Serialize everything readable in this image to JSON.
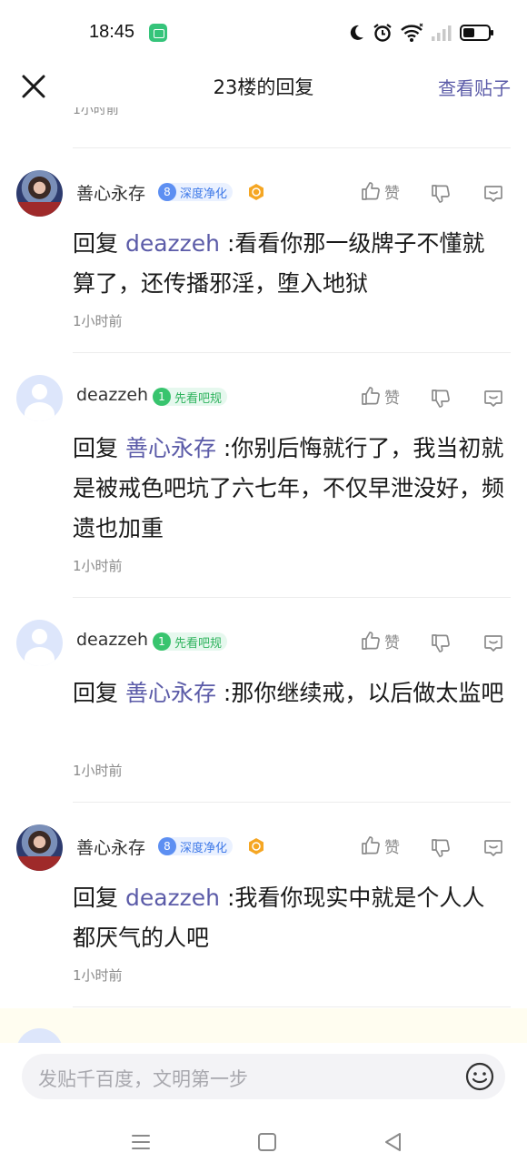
{
  "status_bar": {
    "time": "18:45",
    "icons": [
      "app-icon",
      "moon-icon",
      "alarm-icon",
      "wifi-icon",
      "signal-icon",
      "battery-icon"
    ]
  },
  "nav": {
    "title": "23楼的回复",
    "view_post": "查看贴子"
  },
  "partial_top_time": "1小时前",
  "colors": {
    "mention": "#5b5ba8",
    "badge_blue": "#3e79e8",
    "badge_green": "#2fb35e",
    "medal": "#f5a623"
  },
  "comments": [
    {
      "username": "善心永存",
      "badge_level": "8",
      "badge_title": "深度净化",
      "has_medal": true,
      "like_label": "赞",
      "reply_prefix": "回复 ",
      "mention": "deazzeh",
      "text": " :看看你那一级牌子不懂就算了，还传播邪淫，堕入地狱",
      "time": "1小时前"
    },
    {
      "username": "deazzeh",
      "badge_level": "1",
      "badge_title": "先看吧规",
      "has_medal": false,
      "like_label": "赞",
      "reply_prefix": "回复 ",
      "mention": "善心永存",
      "text": " :你别后悔就行了，我当初就是被戒色吧坑了六七年，不仅早泄没好，频遗也加重",
      "time": "1小时前"
    },
    {
      "username": "deazzeh",
      "badge_level": "1",
      "badge_title": "先看吧规",
      "has_medal": false,
      "like_label": "赞",
      "reply_prefix": "回复 ",
      "mention": "善心永存",
      "text": " :那你继续戒，以后做太监吧",
      "time": "1小时前"
    },
    {
      "username": "善心永存",
      "badge_level": "8",
      "badge_title": "深度净化",
      "has_medal": true,
      "like_label": "赞",
      "reply_prefix": "回复 ",
      "mention": "deazzeh",
      "text": " :我看你现实中就是个人人都厌气的人吧",
      "time": "1小时前"
    }
  ],
  "input": {
    "placeholder": "发贴千百度，文明第一步"
  },
  "system_nav": [
    "menu-icon",
    "home-icon",
    "back-icon"
  ]
}
